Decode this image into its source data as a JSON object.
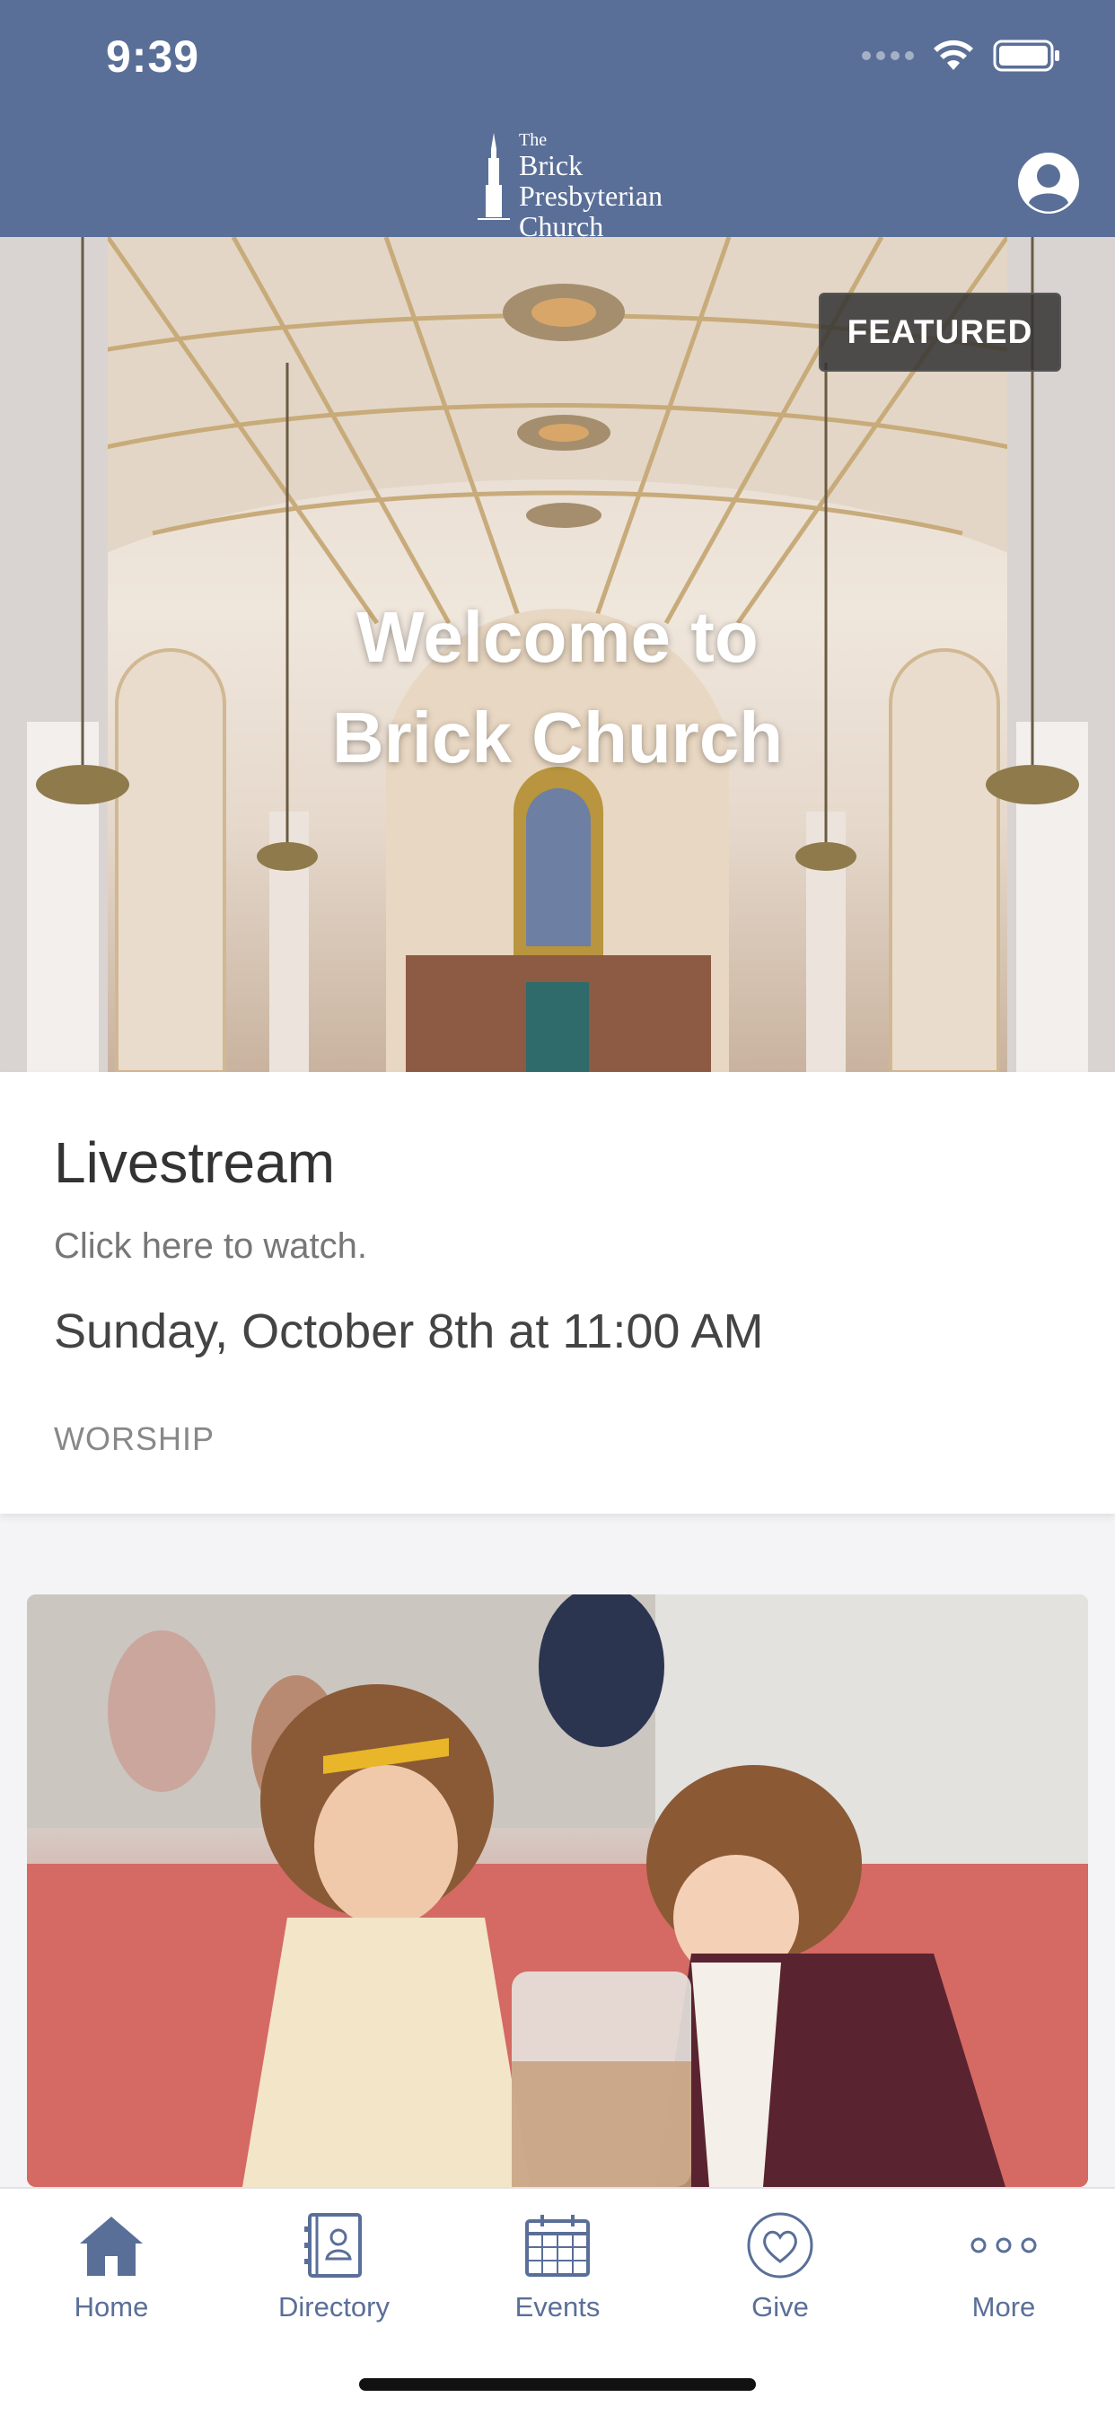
{
  "status_bar": {
    "time": "9:39"
  },
  "header": {
    "logo": {
      "line1": "The",
      "line2": "Brick",
      "line3": "Presbyterian",
      "line4": "Church"
    }
  },
  "featured": {
    "badge": "FEATURED",
    "title_line1": "Welcome to",
    "title_line2": "Brick Church"
  },
  "livestream_card": {
    "title": "Livestream",
    "subtitle": "Click here to watch.",
    "datetime": "Sunday, October 8th at 11:00 AM",
    "category": "WORSHIP"
  },
  "tabs": [
    {
      "label": "Home",
      "icon": "home-icon"
    },
    {
      "label": "Directory",
      "icon": "directory-icon"
    },
    {
      "label": "Events",
      "icon": "calendar-icon"
    },
    {
      "label": "Give",
      "icon": "heart-icon"
    },
    {
      "label": "More",
      "icon": "more-icon"
    }
  ],
  "colors": {
    "header_bg": "#5a6f98",
    "tab_tint": "#5a6f98",
    "card_bg": "#ffffff"
  }
}
